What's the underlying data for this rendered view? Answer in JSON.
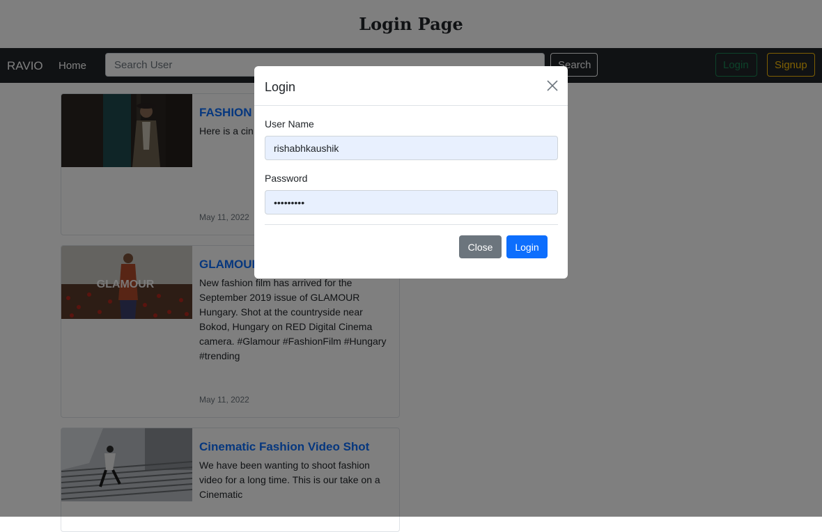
{
  "page_title": "Login Page",
  "navbar": {
    "brand": "RAVIO",
    "home": "Home",
    "search_placeholder": "Search User",
    "search_button": "Search",
    "login_button": "Login",
    "signup_button": "Signup"
  },
  "cards": [
    {
      "title": "FASHION VIDEO-HO CREATION",
      "text": "Here is a cin Fashion & Li #trending #l",
      "date": "May 11, 2022"
    },
    {
      "title": "GLAMOUR",
      "text": "New fashion film has arrived for the September 2019 issue of GLAMOUR Hungary. Shot at the countryside near Bokod, Hungary on RED Digital Cinema camera. #Glamour #FashionFilm #Hungary #trending",
      "date": "May 11, 2022",
      "thumb_text": "GLAMOUR"
    },
    {
      "title": "Cinematic Fashion Video Shot",
      "text": "We have been wanting to shoot fashion video for a long time. This is our take on a Cinematic"
    }
  ],
  "modal": {
    "title": "Login",
    "username_label": "User Name",
    "username_value": "rishabhkaushik",
    "password_label": "Password",
    "password_value": "rishabhk1",
    "close_button": "Close",
    "login_button": "Login"
  },
  "colors": {
    "primary": "#0d6efd",
    "secondary": "#6c757d",
    "navbar": "#212529",
    "success": "#198754",
    "warning": "#ffc107"
  },
  "icons": {
    "modal_close": "close-icon"
  }
}
